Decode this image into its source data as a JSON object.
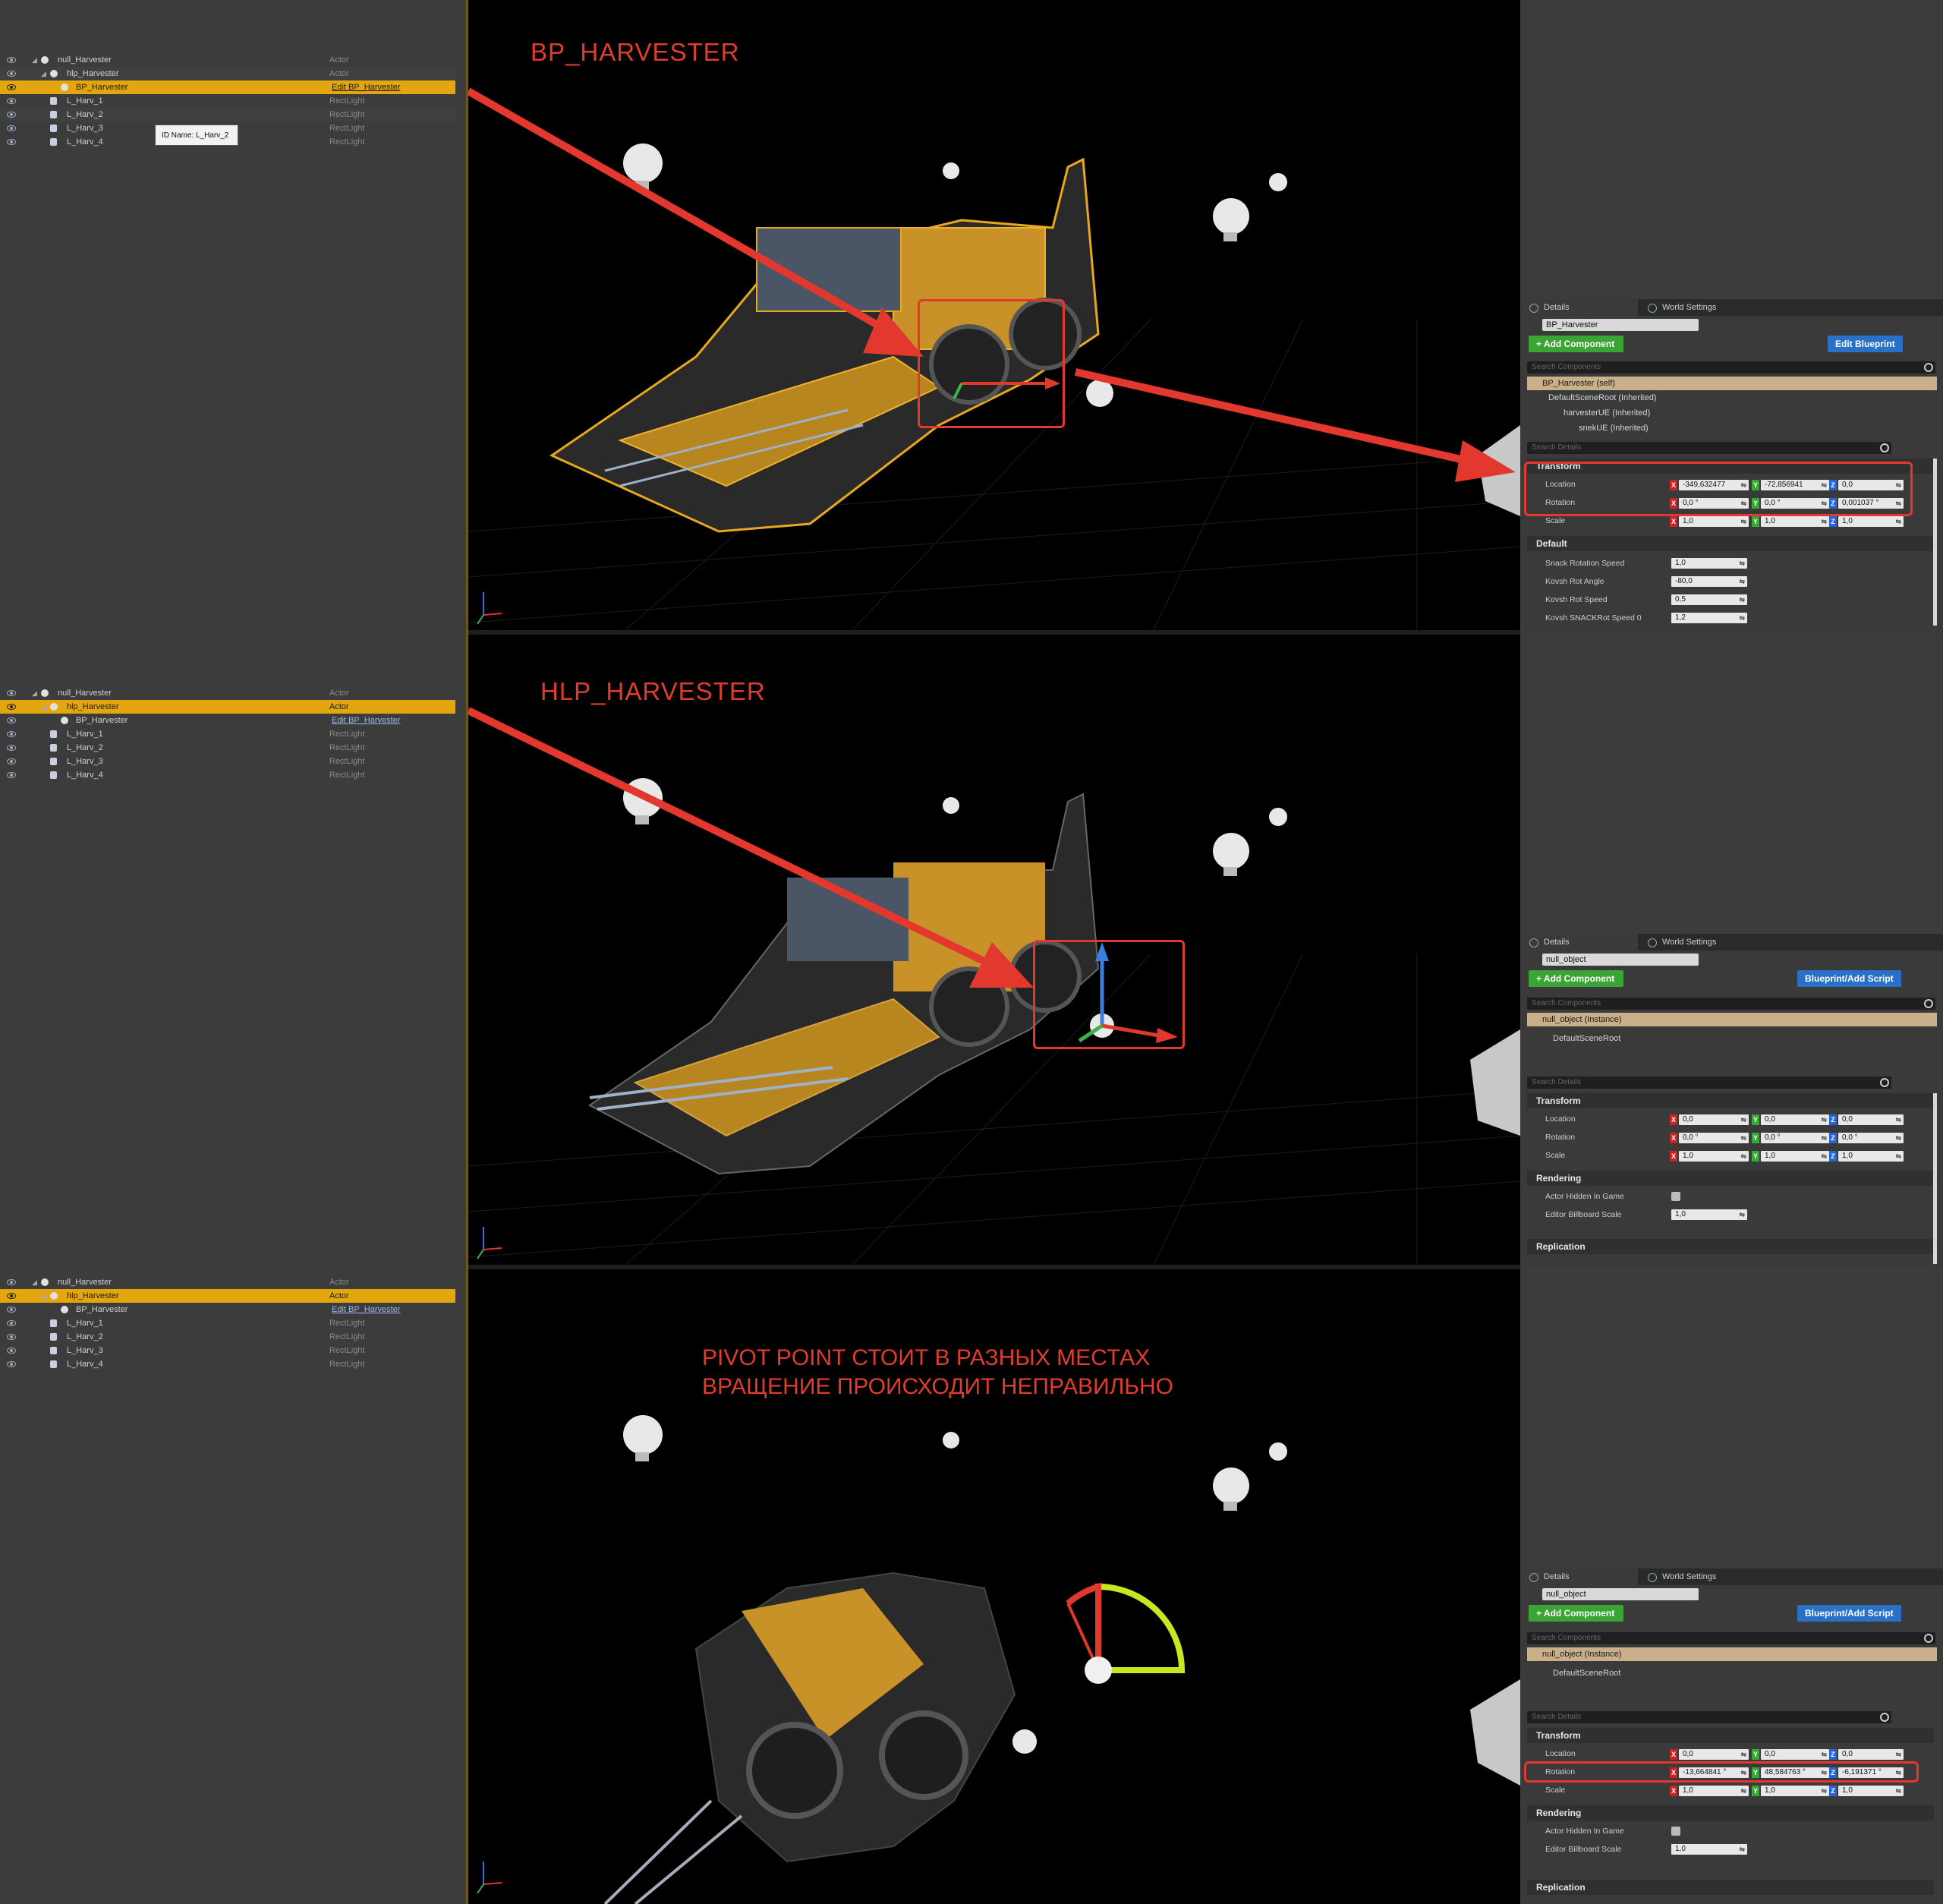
{
  "outliner": {
    "panel1": [
      {
        "name": "null_Harvester",
        "type": "Actor"
      },
      {
        "name": "hlp_Harvester",
        "type": "Actor"
      },
      {
        "name": "BP_Harvester",
        "type": "Edit BP_Harvester"
      },
      {
        "name": "L_Harv_1",
        "type": "RectLight"
      },
      {
        "name": "L_Harv_2",
        "type": "RectLight"
      },
      {
        "name": "L_Harv_3",
        "type": "RectLight"
      },
      {
        "name": "L_Harv_4",
        "type": "RectLight"
      }
    ],
    "tooltip": "ID Name: L_Harv_2",
    "panel2": [
      {
        "name": "null_Harvester",
        "type": "Actor"
      },
      {
        "name": "hlp_Harvester",
        "type": "Actor"
      },
      {
        "name": "BP_Harvester",
        "type": "Edit BP_Harvester"
      },
      {
        "name": "L_Harv_1",
        "type": "RectLight"
      },
      {
        "name": "L_Harv_2",
        "type": "RectLight"
      },
      {
        "name": "L_Harv_3",
        "type": "RectLight"
      },
      {
        "name": "L_Harv_4",
        "type": "RectLight"
      }
    ],
    "panel3": [
      {
        "name": "null_Harvester",
        "type": "Actor"
      },
      {
        "name": "hlp_Harvester",
        "type": "Actor"
      },
      {
        "name": "BP_Harvester",
        "type": "Edit BP_Harvester"
      },
      {
        "name": "L_Harv_1",
        "type": "RectLight"
      },
      {
        "name": "L_Harv_2",
        "type": "RectLight"
      },
      {
        "name": "L_Harv_3",
        "type": "RectLight"
      },
      {
        "name": "L_Harv_4",
        "type": "RectLight"
      }
    ]
  },
  "viewports": {
    "label1": "BP_HARVESTER",
    "label2": "HLP_HARVESTER",
    "note_line1": "PIVOT POINT СТОИТ В РАЗНЫХ МЕСТАХ",
    "note_line2": "ВРАЩЕНИЕ ПРОИСХОДИТ НЕПРАВИЛЬНО"
  },
  "details1": {
    "tab_details": "Details",
    "tab_world": "World Settings",
    "object_name": "BP_Harvester",
    "add_component": "+ Add Component",
    "blueprint_button": "Edit Blueprint",
    "search_components": "Search Components",
    "self_row": "BP_Harvester (self)",
    "components": [
      "DefaultSceneRoot (Inherited)",
      "harvesterUE (Inherited)",
      "snekUE (Inherited)"
    ],
    "search_details": "Search Details",
    "transform_title": "Transform",
    "location_label": "Location",
    "location": [
      "-349,632477",
      "-72,856941",
      "0,0"
    ],
    "rotation_label": "Rotation",
    "rotation": [
      "0,0 °",
      "0,0 °",
      "0,001037 °"
    ],
    "scale_label": "Scale",
    "scale": [
      "1,0",
      "1,0",
      "1,0"
    ],
    "default_title": "Default",
    "props": [
      {
        "label": "Snack Rotation Speed",
        "value": "1,0"
      },
      {
        "label": "Kovsh Rot Angle",
        "value": "-80,0"
      },
      {
        "label": "Kovsh Rot Speed",
        "value": "0,5"
      },
      {
        "label": "Kovsh SNACKRot Speed 0",
        "value": "1,2"
      }
    ]
  },
  "details2": {
    "tab_details": "Details",
    "tab_world": "World Settings",
    "object_name": "null_object",
    "add_component": "+ Add Component",
    "blueprint_button": "Blueprint/Add Script",
    "search_components": "Search Components",
    "self_row": "null_object (Instance)",
    "components": [
      "DefaultSceneRoot"
    ],
    "search_details": "Search Details",
    "transform_title": "Transform",
    "location_label": "Location",
    "location": [
      "0,0",
      "0,0",
      "0,0"
    ],
    "rotation_label": "Rotation",
    "rotation": [
      "0,0 °",
      "0,0 °",
      "0,0 °"
    ],
    "scale_label": "Scale",
    "scale": [
      "1,0",
      "1,0",
      "1,0"
    ],
    "rendering_title": "Rendering",
    "hidden_label": "Actor Hidden In Game",
    "billboard_label": "Editor Billboard Scale",
    "billboard_value": "1,0",
    "replication_title": "Replication"
  },
  "details3": {
    "tab_details": "Details",
    "tab_world": "World Settings",
    "object_name": "null_object",
    "add_component": "+ Add Component",
    "blueprint_button": "Blueprint/Add Script",
    "search_components": "Search Components",
    "self_row": "null_object (Instance)",
    "components": [
      "DefaultSceneRoot"
    ],
    "search_details": "Search Details",
    "transform_title": "Transform",
    "location_label": "Location",
    "location": [
      "0,0",
      "0,0",
      "0,0"
    ],
    "rotation_label": "Rotation",
    "rotation": [
      "-13,664841 °",
      "48,584763 °",
      "-6,191371 °"
    ],
    "scale_label": "Scale",
    "scale": [
      "1,0",
      "1,0",
      "1,0"
    ],
    "rendering_title": "Rendering",
    "hidden_label": "Actor Hidden In Game",
    "billboard_label": "Editor Billboard Scale",
    "billboard_value": "1,0",
    "replication_title": "Replication"
  },
  "colors": {
    "selection": "#e3a60f",
    "annotation_red": "#e2382e",
    "add_green": "#3aa534",
    "blueprint_blue": "#2970c8",
    "viewport_bg": "#000000",
    "panel_bg": "#3c3c3c"
  }
}
